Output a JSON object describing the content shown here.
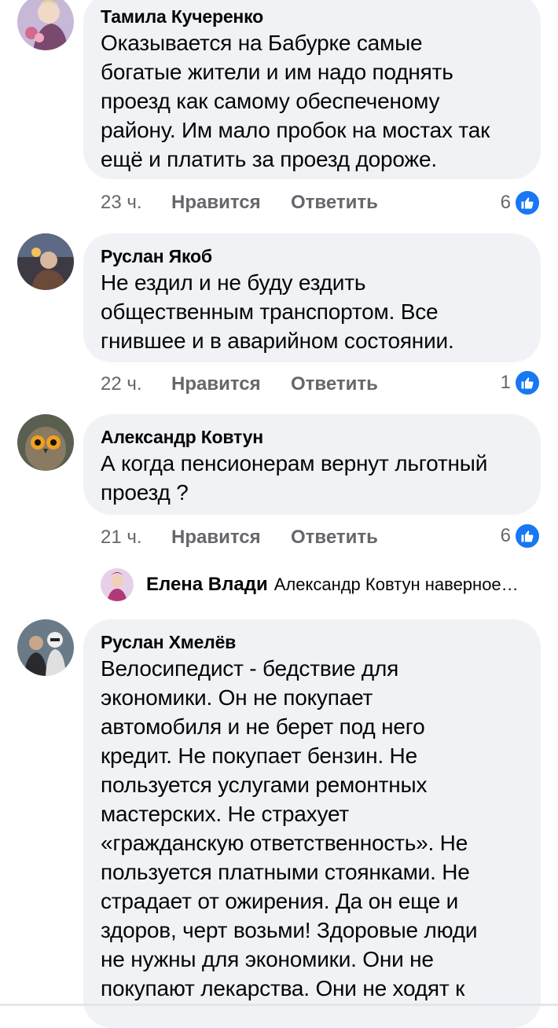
{
  "comments": [
    {
      "author": "Тамила Кучеренко",
      "lines": [
        "Оказывается на Бабурке самые",
        "богатые жители и им надо поднять",
        "проезд как самому обеспеченому",
        "району. Им мало пробок на мостах так",
        "ещё и платить за проезд дороже."
      ],
      "time": "23 ч.",
      "like_label": "Нравится",
      "reply_label": "Ответить",
      "reactions": "6"
    },
    {
      "author": "Руслан Якоб",
      "lines": [
        "Не ездил и не буду ездить",
        "общественным транспортом. Все",
        "гнившее и в аварийном состоянии."
      ],
      "time": "22 ч.",
      "like_label": "Нравится",
      "reply_label": "Ответить",
      "reactions": "1"
    },
    {
      "author": "Александр Ковтун",
      "lines": [
        "А когда пенсионерам вернут льготный",
        "проезд ?"
      ],
      "time": "21 ч.",
      "like_label": "Нравится",
      "reply_label": "Ответить",
      "reactions": "6"
    },
    {
      "author": "Руслан Хмелёв",
      "lines": [
        "Велосипедист - бедствие для",
        "экономики. Он не покупает",
        "автомобиля и не берет под него",
        "кредит. Не покупает бензин. Не",
        "пользуется услугами ремонтных",
        "мастерских. Не страхует",
        "«гражданскую ответственность». Не",
        "пользуется платными стоянками. Не",
        "страдает от ожирения. Да он еще и",
        "здоров, черт возьми! Здоровые люди",
        "не нужны для экономики. Они не",
        "покупают лекарства. Они не ходят к"
      ]
    }
  ],
  "reply_preview": {
    "author": "Елена Влади",
    "text": "Александр Ковтун наверное…"
  },
  "colors": {
    "like_blue": "#1877f2",
    "bubble": "#f0f2f5",
    "meta": "#65676b"
  },
  "icons": [
    "like-reaction-icon",
    "avatar"
  ]
}
